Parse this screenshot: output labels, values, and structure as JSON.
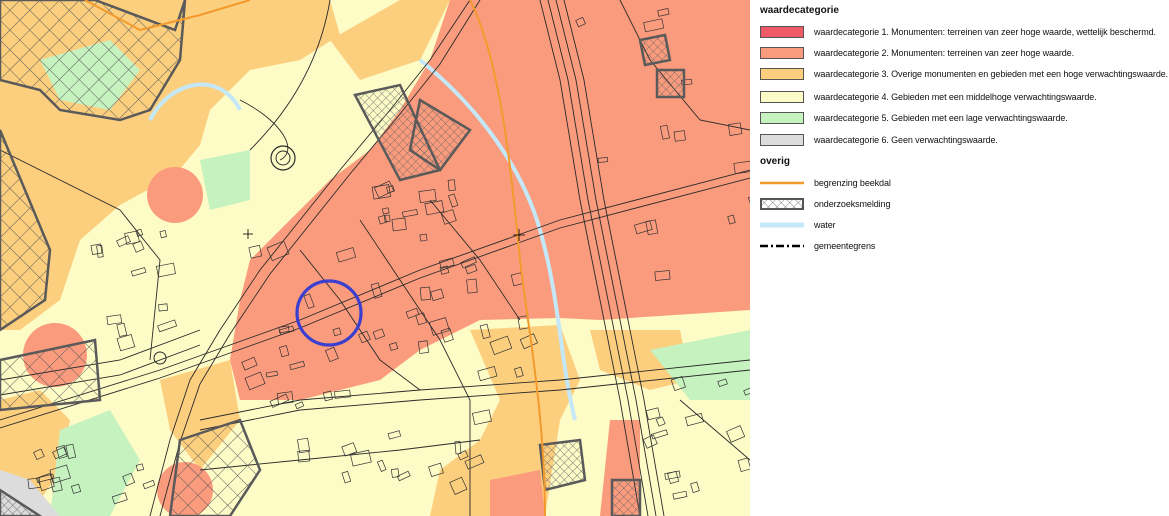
{
  "legend": {
    "category_title": "waardecategorie",
    "categories": [
      {
        "label": "waardecategorie 1. Monumenten: terreinen van zeer hoge waarde, wettelijk beschermd.",
        "color": "#ee5a66"
      },
      {
        "label": "waardecategorie 2. Monumenten: terreinen van zeer hoge waarde.",
        "color": "#fa9b7d"
      },
      {
        "label": "waardecategorie 3. Overige monumenten en gebieden met een hoge verwachtingswaarde.",
        "color": "#fccf7f"
      },
      {
        "label": "waardecategorie 4. Gebieden met een middelhoge verwachtingswaarde.",
        "color": "#fdfbc6"
      },
      {
        "label": "waardecategorie 5. Gebieden met een lage verwachtingswaarde.",
        "color": "#c6f2c0"
      },
      {
        "label": "waardecategorie 6. Geen verwachtingswaarde.",
        "color": "#dcdcdc"
      }
    ],
    "other_title": "overig",
    "other": [
      {
        "label": "begrenzing beekdal",
        "symbol": "orange-line",
        "color": "#f39a2c"
      },
      {
        "label": "onderzoeksmelding",
        "symbol": "crosshatch",
        "color": "#555555"
      },
      {
        "label": "water",
        "symbol": "water-line",
        "color": "#c4e8f8"
      },
      {
        "label": "gemeentegrens",
        "symbol": "dash-dot-line",
        "color": "#000000"
      }
    ]
  },
  "map": {
    "marker_color": "#3a3fd0",
    "beekdal_color": "#f39a2c",
    "water_color": "#c4e8f8"
  }
}
